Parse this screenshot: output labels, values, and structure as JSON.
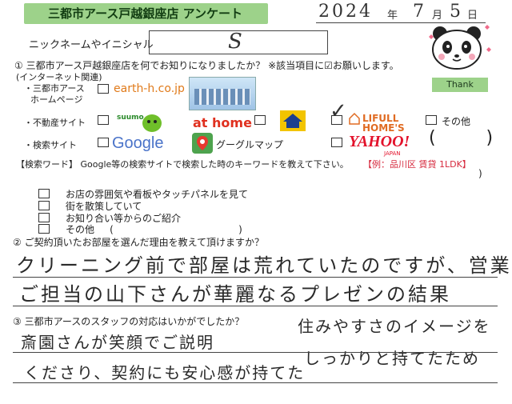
{
  "header": {
    "title": "三都市アース戸越銀座店 アンケート",
    "date": {
      "year": "2024",
      "year_unit": "年",
      "month": "7",
      "month_unit": "月",
      "day": "5",
      "day_unit": "日"
    }
  },
  "nickname": {
    "label": "ニックネームやイニシャル",
    "value": "S"
  },
  "q1": {
    "text": "① 三都市アース戸越銀座店を何でお知りになりましたか？ ※該当項目に☑お願いします。",
    "note": "(インターネット関連)",
    "homepage": {
      "label_line1": "・三都市アース",
      "label_line2": "ホームページ",
      "site": "earth-h.co.jp"
    },
    "realestate": {
      "label": "・不動産サイト",
      "suumo": "suumo",
      "athome": "at home",
      "lifull": "LIFULL HOME'S",
      "other": "その他",
      "checked_mark": "✓"
    },
    "search": {
      "label": "・検索サイト",
      "google": "Google",
      "googlemap": "グーグルマップ",
      "yahoo": "YAHOO!",
      "yahoo_sub": "JAPAN",
      "paren": "(         )"
    },
    "keyword": {
      "label": "【検索ワード】 Google等の検索サイトで検索した時のキーワードを教えて下さい。",
      "example": "【例：品川区 賃貸 1LDK】",
      "close": ")"
    },
    "offline": [
      "お店の雰囲気や看板やタッチパネルを見て",
      "街を散策していて",
      "お知り合い等からのご紹介",
      "その他     (                                         )"
    ]
  },
  "q2": {
    "text": "② ご契約頂いたお部屋を選んだ理由を教えて頂けますか？",
    "answer_line1": "クリーニング前で部屋は荒れていたのですが、営業",
    "answer_line2": "ご担当の山下さんが華麗なるプレゼンの結果"
  },
  "q3": {
    "text": "③ 三都市アースのスタッフの対応はいかがでしたか？",
    "answer_left_line1": "斎園さんが笑顔でご説明",
    "answer_left_line2": "くださり、契約にも安心感が持てた",
    "answer_right_line1": "住みやすさのイメージを",
    "answer_right_line2": "しっかりと持てたため"
  },
  "mascot": {
    "thank": "Thank"
  }
}
